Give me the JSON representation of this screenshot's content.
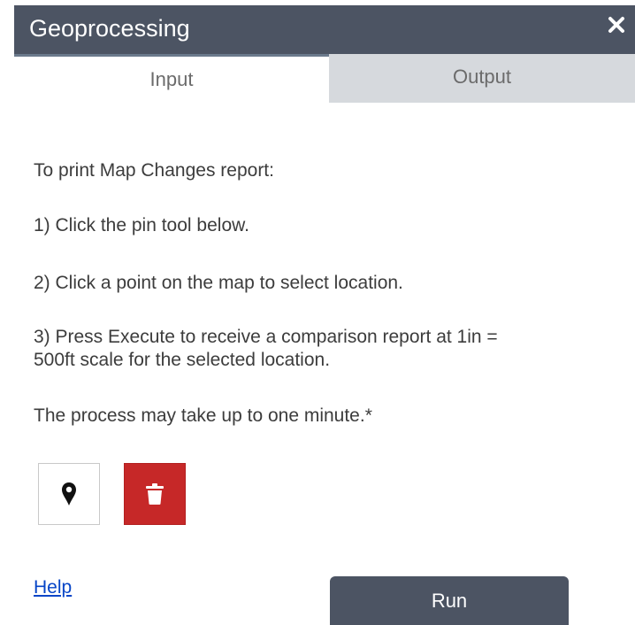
{
  "window": {
    "title": "Geoprocessing",
    "close_glyph": "✕",
    "close_icon": "close-icon"
  },
  "tabs": [
    {
      "label": "Input",
      "active": true
    },
    {
      "label": "Output",
      "active": false
    }
  ],
  "instructions": {
    "intro": "To print Map Changes report:",
    "step1": "1) Click the pin tool below.",
    "step2": "2) Click a point on the map to select location.",
    "step3_line1": "3) Press Execute to receive a comparison report at 1in =",
    "step3_line2": "500ft scale for the selected location.",
    "note": "The process may take up to one minute.*"
  },
  "tools": {
    "pin_icon": "map-pin-icon",
    "delete_icon": "trash-icon"
  },
  "footer": {
    "help_label": "Help",
    "run_label": "Run"
  },
  "colors": {
    "header_bg": "#4c5463",
    "delete_bg": "#c62828",
    "link": "#0645c7",
    "inactive_tab_bg": "#d6d9dd"
  }
}
